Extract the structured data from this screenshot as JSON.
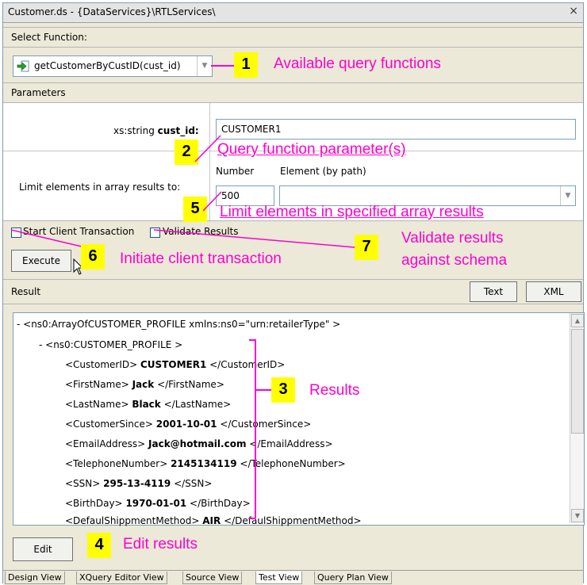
{
  "window": {
    "title": "Customer.ds - {DataServices}\\RTLServices\\",
    "close": "×"
  },
  "select_function": {
    "header": "Select Function:",
    "selected": "getCustomerByCustID(cust_id)"
  },
  "parameters": {
    "header": "Parameters",
    "param_type": "xs:string ",
    "param_name": "cust_id:",
    "param_value": "CUSTOMER1",
    "limit_label": "Limit elements in array results to:",
    "number_col": "Number",
    "element_col": "Element (by path)",
    "limit_value": "500",
    "element_value": ""
  },
  "options": {
    "start_client_transaction": "Start Client Transaction",
    "validate_results": "Validate Results",
    "start_checked": false,
    "validate_checked": false,
    "execute": "Execute"
  },
  "result": {
    "header": "Result",
    "text_btn": "Text",
    "xml_btn": "XML",
    "lines": [
      {
        "pre": "-  <ns0:ArrayOfCUSTOMER_PROFILE xmlns:ns0=\"urn:retailerType\" >",
        "val": "",
        "post": ""
      },
      {
        "pre": "-  <ns0:CUSTOMER_PROFILE >",
        "val": "",
        "post": ""
      },
      {
        "pre": "<CustomerID> ",
        "val": "CUSTOMER1",
        "post": " </CustomerID>"
      },
      {
        "pre": "<FirstName> ",
        "val": "Jack",
        "post": " </FirstName>"
      },
      {
        "pre": "<LastName> ",
        "val": "Black",
        "post": " </LastName>"
      },
      {
        "pre": "<CustomerSince> ",
        "val": "2001-10-01",
        "post": " </CustomerSince>"
      },
      {
        "pre": "<EmailAddress> ",
        "val": "Jack@hotmail.com",
        "post": " </EmailAddress>"
      },
      {
        "pre": "<TelephoneNumber> ",
        "val": "2145134119",
        "post": " </TelephoneNumber>"
      },
      {
        "pre": "<SSN> ",
        "val": "295-13-4119",
        "post": " </SSN>"
      },
      {
        "pre": "<BirthDay> ",
        "val": "1970-01-01",
        "post": " </BirthDay>"
      },
      {
        "pre": "<DefaulShippmentMethod> ",
        "val": "AIR",
        "post": " </DefaulShippmentMethod>"
      }
    ],
    "edit": "Edit"
  },
  "annotations": {
    "a1": {
      "num": "1",
      "text": "Available query functions"
    },
    "a2": {
      "num": "2",
      "text": "Query function parameter(s)"
    },
    "a3": {
      "num": "3",
      "text": "Results"
    },
    "a4": {
      "num": "4",
      "text": "Edit results"
    },
    "a5": {
      "num": "5",
      "text": "Limit elements in specified array results"
    },
    "a6": {
      "num": "6",
      "text": "Initiate client transaction"
    },
    "a7": {
      "num": "7",
      "text_line1": "Validate results",
      "text_line2": "against schema"
    }
  },
  "tabs": [
    "Design View",
    "XQuery Editor View",
    "Source View",
    "Test View",
    "Query Plan View"
  ],
  "active_tab": "Test View",
  "colors": {
    "annotation": "#ff00cc",
    "badge": "#ffff00",
    "panel": "#ece9d8"
  },
  "icons": {
    "function": "run-arrow-icon",
    "close": "close-icon",
    "dropdown": "chevron-down-icon"
  }
}
